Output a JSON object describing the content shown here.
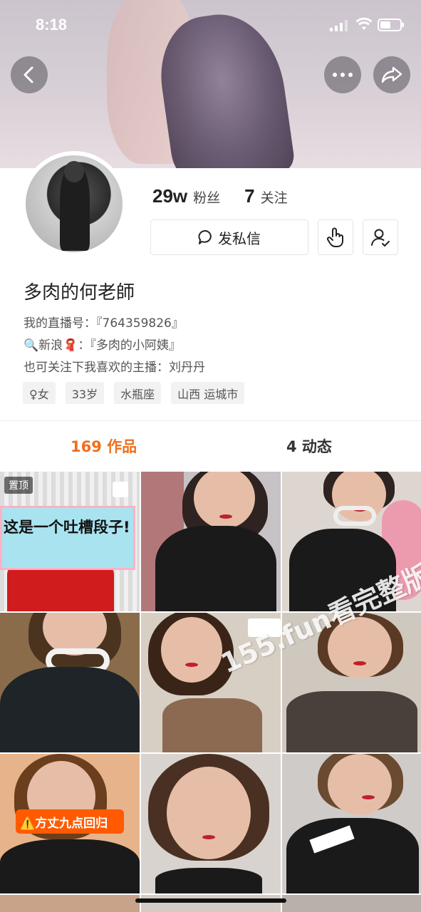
{
  "status_bar": {
    "time": "8:18"
  },
  "profile": {
    "fans_count": "29w",
    "fans_label": "粉丝",
    "following_count": "7",
    "following_label": "关注",
    "message_button": "发私信",
    "name": "多肉的何老師",
    "bio_lines": [
      "我的直播号：『764359826』",
      "🔍新浪🧣：『多肉的小阿姨』",
      "也可关注下我喜欢的主播：刘丹丹"
    ],
    "tags": [
      "♀女",
      "33岁",
      "水瓶座",
      "山西 运城市"
    ]
  },
  "tabs": [
    {
      "label": "169 作品",
      "active": true
    },
    {
      "label": "4 动态",
      "active": false
    }
  ],
  "grid": {
    "pinned_badge": "置顶",
    "sticker_text": "这是一个吐槽段子!",
    "orange_badge": "⚠️方丈九点回归"
  },
  "watermark": "155.fun看完整版",
  "colors": {
    "accent": "#f06f1c",
    "text": "#222222",
    "tag_bg": "#f2f2f2"
  },
  "icons": [
    "back-icon",
    "more-icon",
    "share-icon",
    "chat-bubble-icon",
    "tap-hand-icon",
    "user-check-icon"
  ]
}
